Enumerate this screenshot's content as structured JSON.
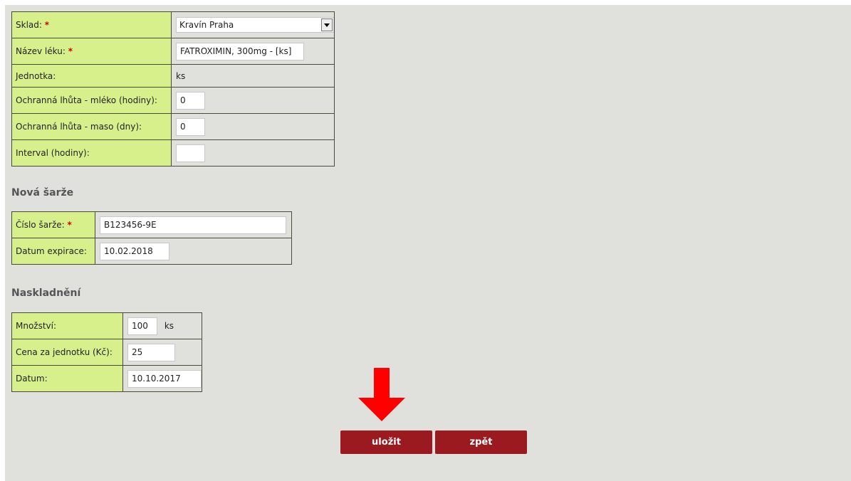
{
  "warehouse_form": {
    "sklad_label": "Sklad:",
    "sklad_value": "Kravín Praha",
    "nazev_label": "Název léku:",
    "nazev_value": "FATROXIMIN, 300mg - [ks]",
    "jednotka_label": "Jednotka:",
    "jednotka_value": "ks",
    "lhuta_mleko_label": "Ochranná lhůta - mléko (hodiny):",
    "lhuta_mleko_value": "0",
    "lhuta_maso_label": "Ochranná lhůta - maso (dny):",
    "lhuta_maso_value": "0",
    "interval_label": "Interval (hodiny):",
    "interval_value": ""
  },
  "batch": {
    "heading": "Nová šarže",
    "cislo_label": "Číslo šarže:",
    "cislo_value": "B123456-9E",
    "expirace_label": "Datum expirace:",
    "expirace_value": "10.02.2018"
  },
  "stock": {
    "heading": "Naskladnění",
    "mnozstvi_label": "Množství:",
    "mnozstvi_value": "100",
    "mnozstvi_unit": "ks",
    "cena_label": "Cena za jednotku (Kč):",
    "cena_value": "25",
    "datum_label": "Datum:",
    "datum_value": "10.10.2017"
  },
  "required_marker": "*",
  "buttons": {
    "save": "uložit",
    "back": "zpět"
  },
  "colors": {
    "label_bg": "#d8f08c",
    "button_bg": "#9b1a20",
    "arrow": "#ff0000",
    "panel_bg": "#e0e0dc"
  }
}
